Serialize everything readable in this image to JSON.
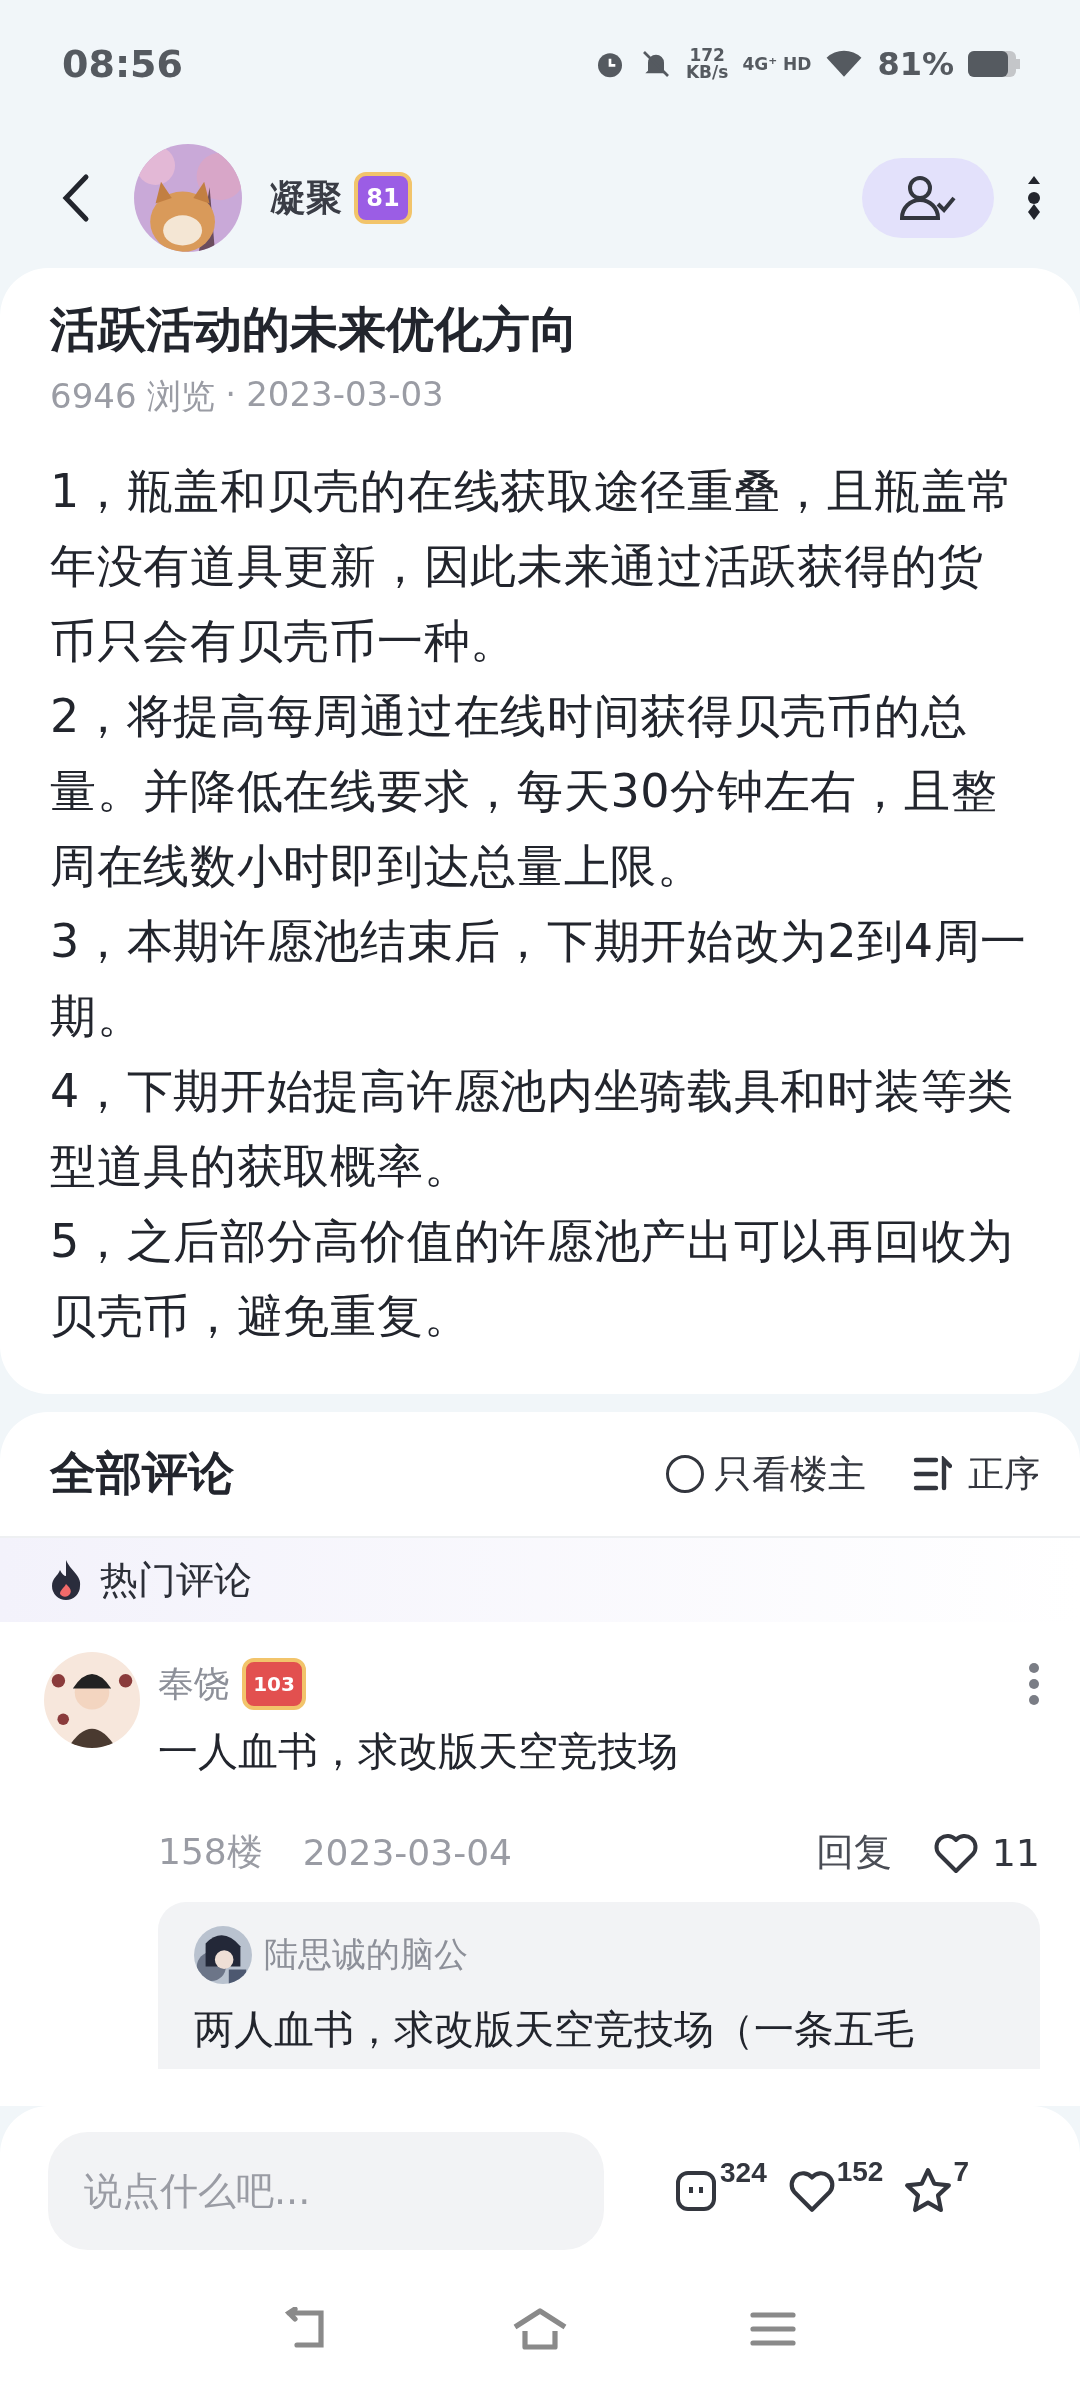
{
  "status_bar": {
    "time": "08:56",
    "speed_value": "172",
    "speed_unit": "KB/s",
    "network": "4G⁺ HD",
    "battery": "81%"
  },
  "header": {
    "username": "凝聚",
    "level": "81",
    "following": true
  },
  "post": {
    "title": "活跃活动的未来优化方向",
    "views": "6946 浏览",
    "separator": "·",
    "date": "2023-03-03",
    "paragraphs": [
      "1，瓶盖和贝壳的在线获取途径重叠，且瓶盖常年没有道具更新，因此未来通过活跃获得的货币只会有贝壳币一种。",
      "2，将提高每周通过在线时间获得贝壳币的总量。并降低在线要求，每天30分钟左右，且整周在线数小时即到达总量上限。",
      "3，本期许愿池结束后，下期开始改为2到4周一期。",
      "4，下期开始提高许愿池内坐骑载具和时装等类型道具的获取概率。",
      "5，之后部分高价值的许愿池产出可以再回收为贝壳币，避免重复。"
    ]
  },
  "comments": {
    "title": "全部评论",
    "filter": {
      "label": "只看楼主",
      "checked": false
    },
    "sort": "正序",
    "hot_label": "热门评论",
    "items": [
      {
        "user": "奉饶",
        "level": "103",
        "text": "一人血书，求改版天空竞技场",
        "floor": "158楼",
        "date": "2023-03-04",
        "reply": "回复",
        "likes": "11",
        "replies": [
          {
            "user": "陆思诚的脑公",
            "text": "两人血书，求改版天空竞技场（一条五毛"
          }
        ]
      }
    ]
  },
  "bottom_bar": {
    "placeholder": "说点什么吧...",
    "comments": "324",
    "likes": "152",
    "favorites": "7"
  }
}
